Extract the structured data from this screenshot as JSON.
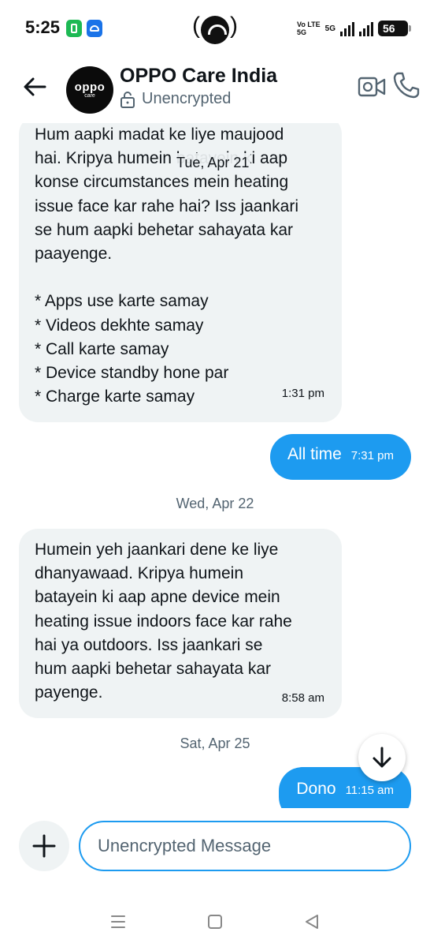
{
  "status_bar": {
    "time": "5:25",
    "volte_top": "Vo LTE",
    "volte_bottom": "5G",
    "network": "5G",
    "battery": "56"
  },
  "header": {
    "contact_name": "OPPO Care India",
    "encryption_label": "Unencrypted",
    "avatar_logo": "oppo",
    "avatar_sub": "care"
  },
  "messages": {
    "floating_date": "Tue, Apr 21",
    "msg1": {
      "text": "Hum aapki madat ke liye maujood\nhai. Kripya humein batayein ki aap\nkonse circumstances mein heating\nissue face kar rahe hai? Iss jaankari\nse hum aapki behetar sahayata kar\npaayenge.\n\n* Apps use karte samay\n* Videos dekhte samay\n* Call karte samay\n* Device standby hone par\n* Charge karte samay",
      "time": "1:31 pm"
    },
    "msg2": {
      "text": "All time",
      "time": "7:31 pm"
    },
    "date2": "Wed, Apr 22",
    "msg3": {
      "text": "Humein yeh jaankari dene ke liye\ndhanyawaad. Kripya humein\nbatayein ki aap apne device mein\nheating issue indoors face kar rahe\nhai ya outdoors. Iss jaankari se\nhum aapki behetar sahayata kar\npayenge.",
      "time": "8:58 am"
    },
    "date3": "Sat, Apr 25",
    "msg4": {
      "text": "Dono",
      "time": "11:15 am"
    }
  },
  "composer": {
    "placeholder": "Unencrypted Message"
  },
  "colors": {
    "accent": "#1d9bf0",
    "incoming_bubble": "#eff3f4",
    "secondary_text": "#536471"
  }
}
